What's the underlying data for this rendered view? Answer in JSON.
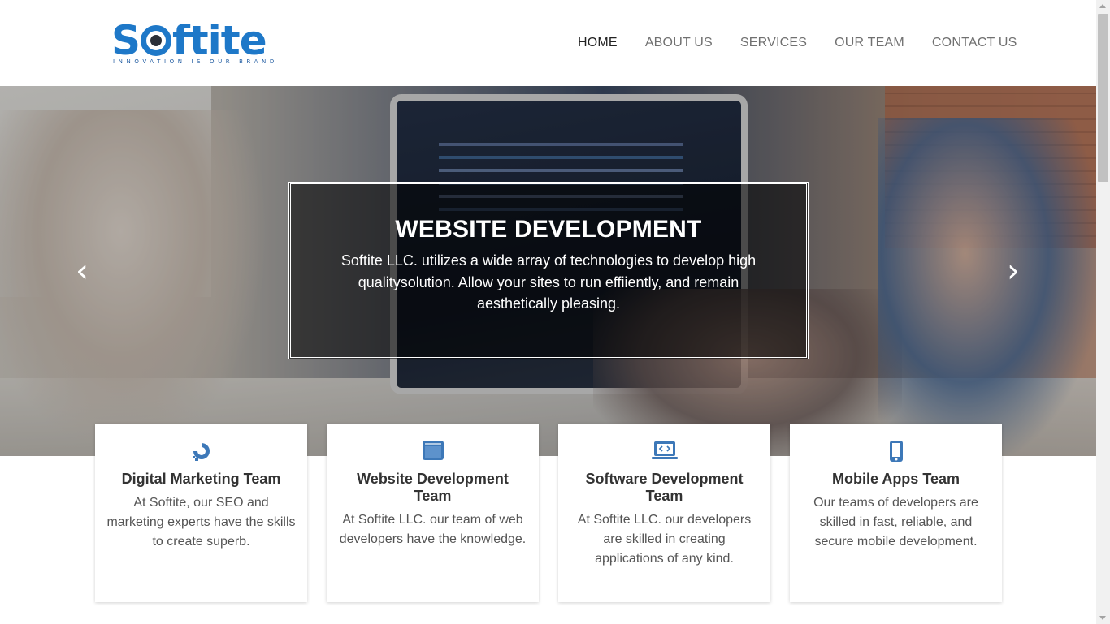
{
  "brand": {
    "name": "Softite",
    "name_prefix": "S",
    "name_suffix": "ftite",
    "tagline": "INNOVATION IS OUR BRAND",
    "color": "#1e78c8"
  },
  "nav": {
    "items": [
      {
        "label": "HOME",
        "active": true
      },
      {
        "label": "ABOUT US",
        "active": false
      },
      {
        "label": "SERVICES",
        "active": false
      },
      {
        "label": "OUR TEAM",
        "active": false
      },
      {
        "label": "CONTACT US",
        "active": false
      }
    ]
  },
  "hero": {
    "title": "WEBSITE DEVELOPMENT",
    "text": "Softite LLC. utilizes a wide array of technologies to develop high qualitysolution. Allow your sites to run effiiently, and remain aesthetically pleasing.",
    "prev_icon": "chevron-left-icon",
    "next_icon": "chevron-right-icon",
    "prev_glyph": "‹",
    "next_glyph": "›"
  },
  "cards": [
    {
      "icon": "digital-ocean-icon",
      "title": "Digital Marketing Team",
      "text": "At Softite, our SEO and marketing experts have the skills to create superb."
    },
    {
      "icon": "browser-window-icon",
      "title": "Website Development Team",
      "text": "At Softite LLC. our team of web developers have the knowledge."
    },
    {
      "icon": "laptop-code-icon",
      "title": "Software Development Team",
      "text": "At Softite LLC. our developers are skilled in creating applications of any kind."
    },
    {
      "icon": "mobile-phone-icon",
      "title": "Mobile Apps Team",
      "text": "Our teams of developers are skilled in fast, reliable, and secure mobile development."
    }
  ],
  "colors": {
    "icon_blue": "#3d78b8",
    "nav_active": "#222222",
    "nav_inactive": "#707070"
  }
}
